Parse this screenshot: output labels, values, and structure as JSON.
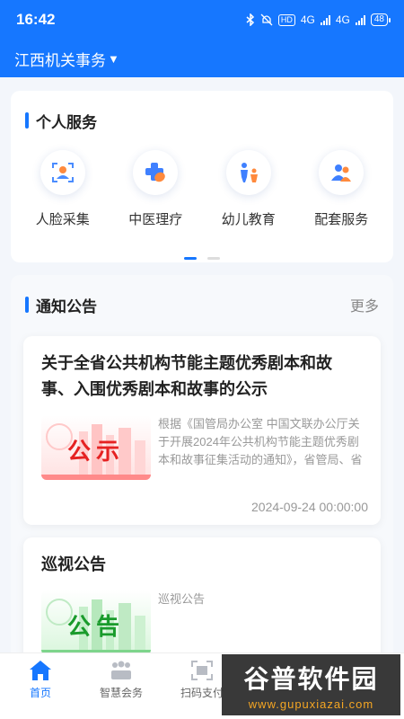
{
  "status_bar": {
    "time": "16:42",
    "network": "4G",
    "battery": "48"
  },
  "header": {
    "org_name": "江西机关事务",
    "org_caret": "▼"
  },
  "personal_services": {
    "title": "个人服务",
    "items": [
      {
        "label": "人脸采集",
        "icon": "face-capture-icon"
      },
      {
        "label": "中医理疗",
        "icon": "tcm-therapy-icon"
      },
      {
        "label": "幼儿教育",
        "icon": "child-education-icon"
      },
      {
        "label": "配套服务",
        "icon": "support-services-icon"
      }
    ],
    "page_indicator": {
      "pages": 2,
      "active": 1
    }
  },
  "notices": {
    "title": "通知公告",
    "more_label": "更多",
    "items": [
      {
        "title": "关于全省公共机构节能主题优秀剧本和故事、入围优秀剧本和故事的公示",
        "thumb_text": "公示",
        "excerpt": "根据《国管局办公室 中国文联办公厅关于开展2024年公共机构节能主题优秀剧本和故事征集活动的通知》，省管局、省文联在全省组织开展了公...",
        "date": "2024-09-24 00:00:00"
      },
      {
        "title": "巡视公告",
        "thumb_text": "公告",
        "excerpt": "巡视公告"
      }
    ]
  },
  "tab_bar": {
    "tabs": [
      {
        "label": "首页",
        "icon": "home-icon",
        "active": true
      },
      {
        "label": "智慧会务",
        "icon": "meeting-icon",
        "active": false
      },
      {
        "label": "扫码支付",
        "icon": "scan-pay-icon",
        "active": false
      }
    ]
  },
  "watermark": {
    "text": "谷普软件园",
    "url": "www.gupuxiazai.com"
  },
  "colors": {
    "primary": "#1677ff",
    "stamp_red": "#e52222",
    "stamp_green": "#1a9b2c"
  }
}
